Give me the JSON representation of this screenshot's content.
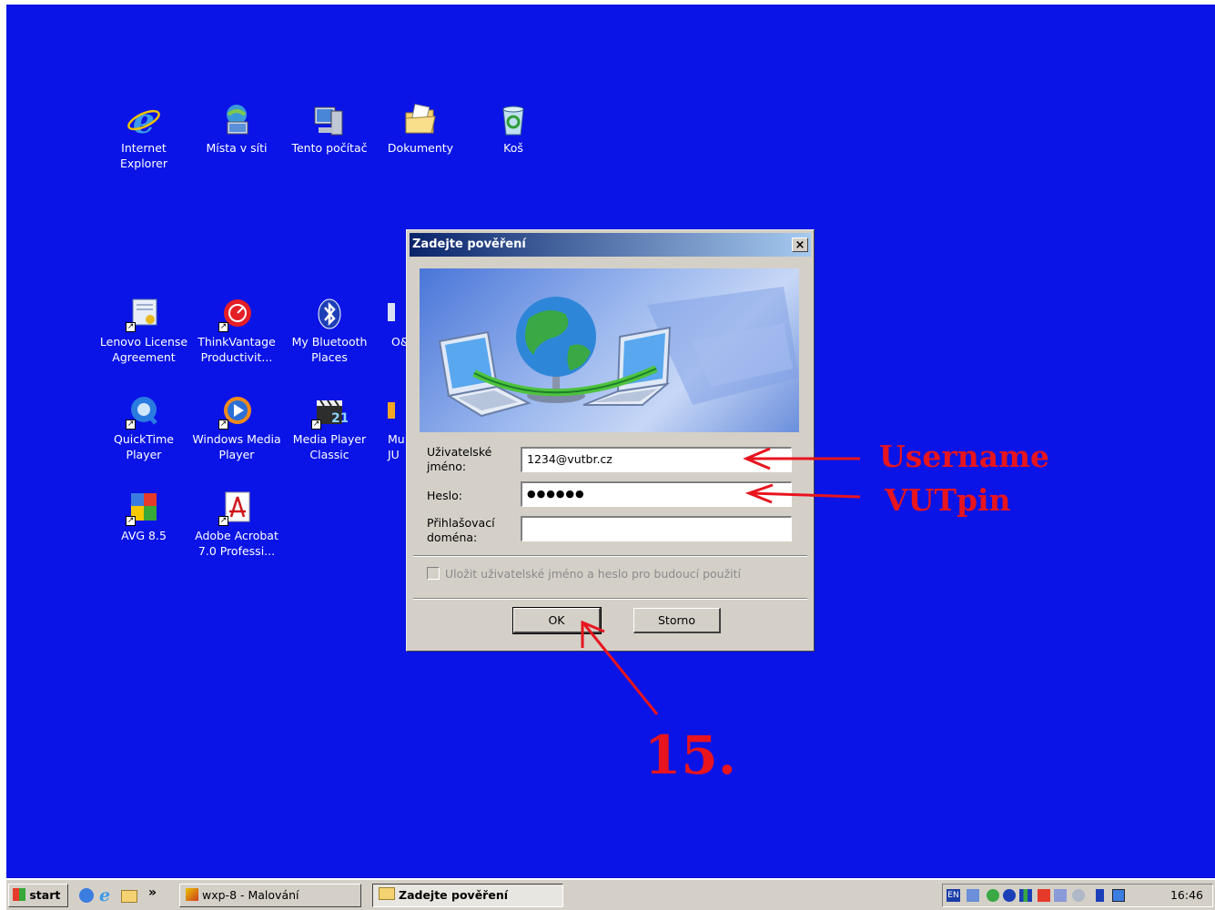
{
  "desktop": {
    "background": "#0a14e6",
    "icons": [
      {
        "label": "Internet\nExplorer",
        "icon": "internet-explorer-icon"
      },
      {
        "label": "Místa v síti",
        "icon": "network-places-icon"
      },
      {
        "label": "Tento počítač",
        "icon": "my-computer-icon"
      },
      {
        "label": "Dokumenty",
        "icon": "documents-folder-icon"
      },
      {
        "label": "Koš",
        "icon": "recycle-bin-icon"
      },
      {
        "label": "Lenovo License\nAgreement",
        "icon": "license-certificate-icon"
      },
      {
        "label": "ThinkVantage\nProductivit...",
        "icon": "thinkvantage-icon"
      },
      {
        "label": "My Bluetooth\nPlaces",
        "icon": "bluetooth-icon"
      },
      {
        "label": "O&",
        "icon": "partially-hidden-icon"
      },
      {
        "label": "QuickTime\nPlayer",
        "icon": "quicktime-icon"
      },
      {
        "label": "Windows Media\nPlayer",
        "icon": "windows-media-player-icon"
      },
      {
        "label": "Media Player\nClassic",
        "icon": "media-player-classic-icon"
      },
      {
        "label": "Mu\nJU",
        "icon": "partially-hidden-icon"
      },
      {
        "label": "AVG 8.5",
        "icon": "avg-antivirus-icon"
      },
      {
        "label": "Adobe Acrobat\n7.0 Professi...",
        "icon": "adobe-acrobat-icon"
      }
    ]
  },
  "dialog": {
    "title": "Zadejte pověření",
    "close_label": "×",
    "username_label": "Uživatelské\njméno:",
    "username_value": "1234@vutbr.cz",
    "password_label": "Heslo:",
    "password_value": "●●●●●●",
    "domain_label": "Přihlašovací\ndoména:",
    "domain_value": "",
    "remember_label": "Uložit uživatelské jméno a heslo pro budoucí použití",
    "ok_label": "OK",
    "cancel_label": "Storno"
  },
  "annotations": {
    "username": "Username",
    "password": "VUTpin",
    "step": "15.",
    "color": "#e8141e"
  },
  "taskbar": {
    "start_label": "start",
    "more_label": "»",
    "tasks": [
      {
        "label": "wxp-8 - Malování"
      },
      {
        "label": "Zadejte pověření"
      }
    ],
    "tray_lang": "EN",
    "clock": "16:46"
  }
}
